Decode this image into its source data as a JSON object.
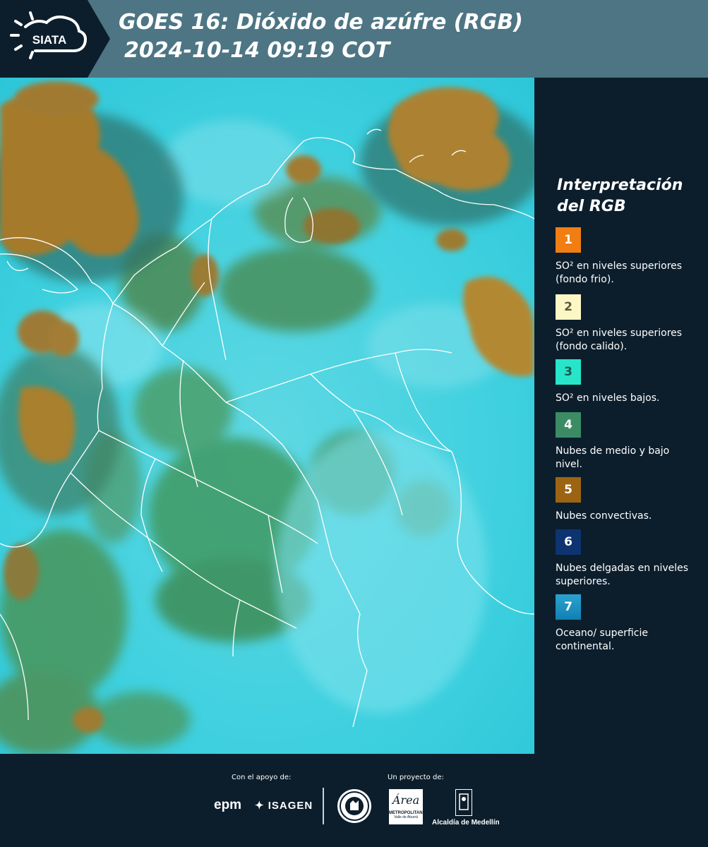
{
  "header": {
    "logo_text": "SIATA",
    "title_line1": "GOES 16: Dióxido de azúfre (RGB)",
    "title_line2": "2024-10-14 09:19 COT"
  },
  "map": {
    "description_colors": {
      "ocean": "#2fd3df",
      "land_cloud": "#3e8f5e",
      "convective": "#a57a2c",
      "border": "#ffffff"
    }
  },
  "legend": {
    "title": "Interpretación del RGB",
    "items": [
      {
        "number": "1",
        "color": "#f07e12",
        "text_color": "#ffffff",
        "label": "SO² en niveles superiores (fondo frio)."
      },
      {
        "number": "2",
        "color": "#fdf7c6",
        "text_color": "#5c5c3c",
        "label": "SO² en niveles superiores (fondo calido)."
      },
      {
        "number": "3",
        "color": "#27e5c9",
        "text_color": "#1b5650",
        "label": "SO² en niveles bajos."
      },
      {
        "number": "4",
        "color": "#3b8c65",
        "text_color": "#ffffff",
        "label": "Nubes de medio y bajo nivel."
      },
      {
        "number": "5",
        "color": "#9c6412",
        "text_color": "#ffffff",
        "label": "Nubes convectivas."
      },
      {
        "number": "6",
        "color": "#0d3470",
        "text_color": "#ffffff",
        "label": "Nubes delgadas en niveles superiores."
      },
      {
        "number": "7",
        "color": "#1996c4",
        "text_color": "#ffffff",
        "label": "Oceano/ superficie continental."
      }
    ]
  },
  "footer": {
    "support_label": "Con el apoyo de:",
    "project_label": "Un proyecto de:",
    "sponsors": {
      "epm": "epm",
      "isagen": "ISAGEN",
      "metro_script": "Área",
      "metro_name": "METROPOLITANA",
      "metro_sub": "Valle de Aburrá",
      "alcaldia": "Alcaldía de Medellín"
    }
  }
}
